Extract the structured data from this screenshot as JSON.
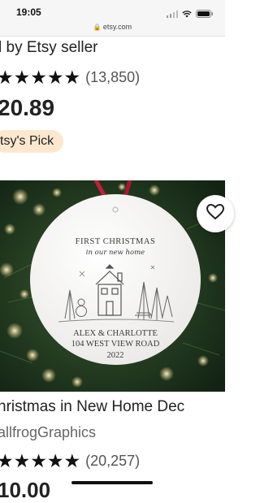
{
  "status": {
    "time": "19:05",
    "url": "etsy.com"
  },
  "listing_prev": {
    "seller_text": "l by Etsy seller",
    "stars": "★★★★★",
    "review_count": "(13,850)",
    "price": "20.89",
    "badge": "tsy's Pick"
  },
  "listing_next": {
    "image": {
      "line1": "FIRST CHRISTMAS",
      "line2": "in our new home",
      "names": "ALEX & CHARLOTTE",
      "address": "104 WEST VIEW ROAD",
      "year": "2022"
    },
    "title": "hristmas in New Home Dec",
    "shop": "allfrogGraphics",
    "stars": "★★★★★",
    "review_count": "(20,257)",
    "price": "10.00"
  },
  "icons": {
    "lock": "lock-icon",
    "favorite": "heart-icon",
    "signal": "signal-icon",
    "wifi": "wifi-icon",
    "battery": "battery-icon"
  },
  "colors": {
    "badge_bg": "#fde8cf",
    "ribbon": "#c0203a",
    "ornament_text": "#3a3a3a"
  }
}
